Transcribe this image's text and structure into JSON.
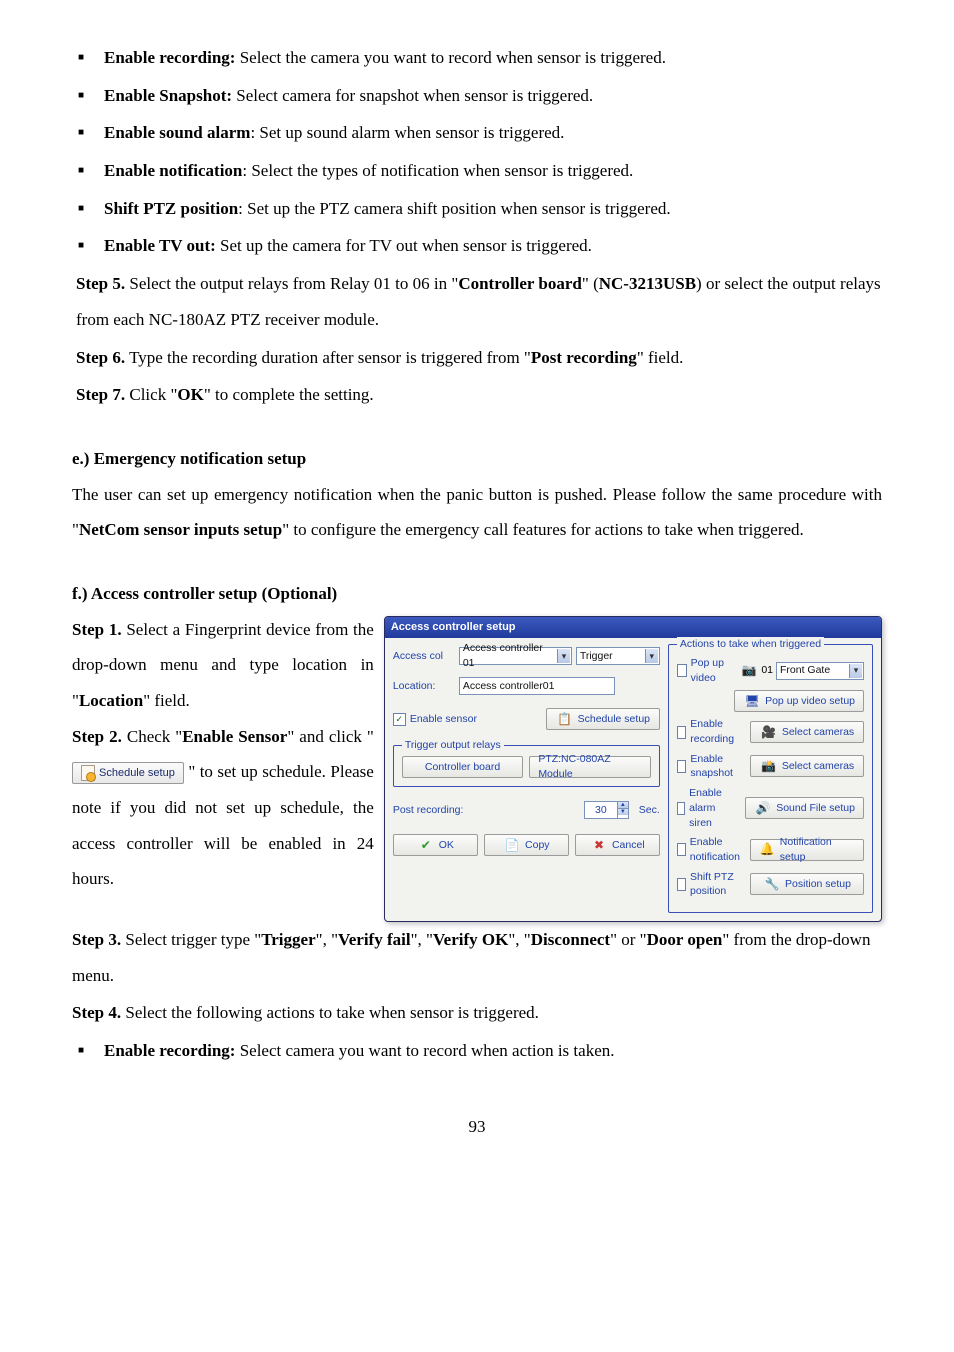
{
  "bullets1": [
    {
      "name": "Enable recording:",
      "desc": " Select the camera you want to record when sensor is triggered."
    },
    {
      "name": "Enable Snapshot:",
      "desc": " Select camera for snapshot when sensor is triggered."
    },
    {
      "name": "Enable sound alarm",
      "desc": ": Set up sound alarm when sensor is triggered."
    },
    {
      "name": "Enable notification",
      "desc": ": Select the types of notification when sensor is triggered."
    },
    {
      "name": "Shift PTZ position",
      "desc": ": Set up the PTZ camera shift position when sensor is triggered."
    },
    {
      "name": "Enable TV out:",
      "desc": " Set up the camera for TV out when sensor is triggered."
    }
  ],
  "step5": {
    "label": "Step 5.",
    "text_a": "  Select the output relays from Relay 01 to 06 in \"",
    "bold1": "Controller board",
    "mid": "\" (",
    "bold2": "NC-3213USB",
    "text_b": ") or select the output relays from each NC-180AZ PTZ receiver module."
  },
  "step6": {
    "label": "Step 6.",
    "text": "  Type the recording duration after sensor is triggered from \"",
    "bold": "Post recording",
    "tail": "\" field."
  },
  "step7": {
    "label": "Step 7.",
    "text": "  Click \"",
    "bold": "OK",
    "tail": "\" to complete the setting."
  },
  "sectE": {
    "heading": "e.) Emergency notification setup",
    "para_a": "The user can set up emergency notification when the panic button is pushed. Please follow the same procedure with \"",
    "bold": "NetCom sensor inputs setup",
    "para_b": "\" to configure the emergency call features for actions to take when triggered."
  },
  "sectF": {
    "heading": "f.) Access controller setup (Optional)",
    "step1": {
      "label": "Step 1.",
      "text_a": " Select a Fingerprint device from the drop-down menu and type location in \"",
      "bold": "Location",
      "text_b": "\" field."
    },
    "step2": {
      "label": "Step 2.",
      "text_a": " Check \"",
      "bold": "Enable Sensor",
      "text_b": "\" and click \"",
      "btn": "Schedule setup",
      "text_c": "\" to set up schedule. Please note if you did not set up schedule, the access controller will be enabled in 24 hours."
    }
  },
  "step3": {
    "label": "Step 3.",
    "text_a": "  Select trigger type \"",
    "opts": [
      "Trigger",
      "Verify fail",
      "Verify OK",
      "Disconnect",
      "Door open"
    ],
    "sep_or": "\", \"",
    "penult_sep": "\", \"",
    "last_sep": "\" or \"",
    "tail": "\" from the drop-down menu."
  },
  "step4": {
    "label": "Step 4.",
    "text": "  Select the following actions to take when sensor is triggered."
  },
  "last_bullet": {
    "name": "Enable recording:",
    "desc": " Select camera you want to record when action is taken."
  },
  "page_number": "93",
  "dialog": {
    "title": "Access controller setup",
    "left": {
      "access_col_lbl": "Access col",
      "access_select": "Access controller 01",
      "trigger_select": "Trigger",
      "location_lbl": "Location:",
      "location_val": "Access controller01",
      "enable_sensor": "Enable sensor",
      "schedule_btn": "Schedule setup",
      "relays_legend": "Trigger output relays",
      "controller_board_btn": "Controller board",
      "ptz_module_btn": "PTZ:NC-080AZ Module",
      "post_recording_lbl": "Post recording:",
      "post_recording_val": "30",
      "sec_lbl": "Sec.",
      "ok_btn": "OK",
      "copy_btn": "Copy",
      "cancel_btn": "Cancel"
    },
    "right": {
      "legend": "Actions to take when triggered",
      "popup_video": "Pop up video",
      "cam_num": "01",
      "cam_select": "Front Gate",
      "popup_video_setup_btn": "Pop up video setup",
      "enable_recording": "Enable recording",
      "select_cameras_btn": "Select cameras",
      "enable_snapshot": "Enable snapshot",
      "select_cameras_btn2": "Select cameras",
      "enable_alarm_siren": "Enable alarm siren",
      "sound_file_setup_btn": "Sound File setup",
      "enable_notification": "Enable notification",
      "notification_setup_btn": "Notification setup",
      "shift_ptz_position": "Shift PTZ position",
      "position_setup_btn": "Position setup"
    }
  }
}
